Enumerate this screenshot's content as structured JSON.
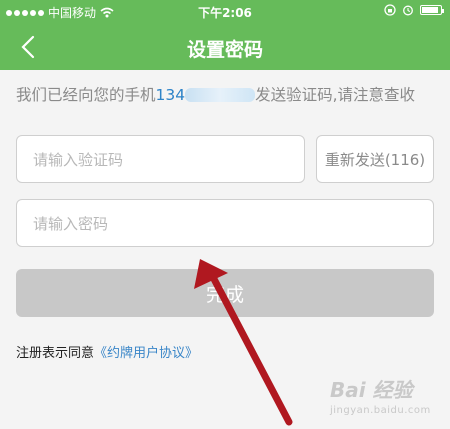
{
  "status_bar": {
    "carrier": "中国移动",
    "time": "下午2:06",
    "battery_level": 0.9
  },
  "nav": {
    "title": "设置密码",
    "back_icon": "chevron-left-icon"
  },
  "notice": {
    "text_before": "我们已经向您的手机",
    "phone_prefix": "134",
    "text_after": "发送验证码,请注意查收"
  },
  "form": {
    "code_placeholder": "请输入验证码",
    "resend_label": "重新发送(116)",
    "password_placeholder": "请输入密码",
    "done_label": "完成"
  },
  "agreement": {
    "prefix": "注册表示同意",
    "link_text": "《约牌用户协议》"
  },
  "watermark": {
    "brand": "Bai 经验",
    "site": "jingyan.baidu.com"
  },
  "colors": {
    "theme_green": "#66bb5a",
    "link_blue": "#3a86c8",
    "annotation_arrow": "#b01820"
  }
}
